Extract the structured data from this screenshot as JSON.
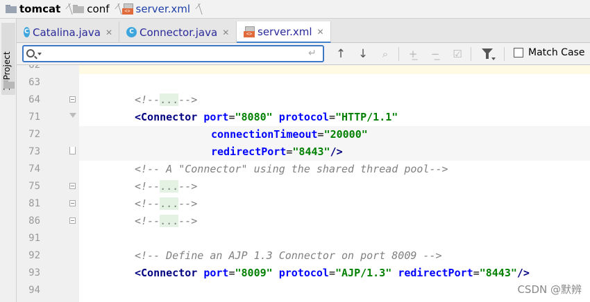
{
  "breadcrumb": {
    "project": "tomcat",
    "folder": "conf",
    "file": "server.xml"
  },
  "left_tool_window": {
    "label": "1: Project"
  },
  "tabs": [
    {
      "label": "Catalina.java",
      "icon": "class-icon",
      "icon_letter": "C",
      "active": false
    },
    {
      "label": "Connector.java",
      "icon": "class-icon",
      "icon_letter": "C",
      "active": false
    },
    {
      "label": "server.xml",
      "icon": "xml-icon",
      "active": true
    }
  ],
  "search": {
    "query": "",
    "match_case_label": "Match Case",
    "match_case_checked": false
  },
  "editor": {
    "lines": [
      {
        "num": "62",
        "text": ""
      },
      {
        "num": "63",
        "text": ""
      },
      {
        "num": "64",
        "text": "<!--...-->"
      },
      {
        "num": "71",
        "text": "<Connector port=\"8080\" protocol=\"HTTP/1.1\""
      },
      {
        "num": "72",
        "text": "connectionTimeout=\"20000\""
      },
      {
        "num": "73",
        "text": "redirectPort=\"8443\" />"
      },
      {
        "num": "74",
        "text": "<!-- A \"Connector\" using the shared thread pool-->"
      },
      {
        "num": "75",
        "text": "<!--...-->"
      },
      {
        "num": "81",
        "text": "<!--...-->"
      },
      {
        "num": "86",
        "text": "<!--...-->"
      },
      {
        "num": "91",
        "text": ""
      },
      {
        "num": "92",
        "text": "<!-- Define an AJP 1.3 Connector on port 8009 -->"
      },
      {
        "num": "93",
        "text": "<Connector port=\"8009\" protocol=\"AJP/1.3\" redirectPort=\"8443\" />"
      },
      {
        "num": "94",
        "text": ""
      }
    ],
    "tokens": {
      "fold_open": "<!--",
      "fold_dots": "...",
      "fold_close": "-->",
      "l74": "<!-- A \"Connector\" using the shared thread pool-->",
      "l92": "<!-- Define an AJP 1.3 Connector on port 8009 -->",
      "tag_open": "<Connector",
      "attr_port": "port",
      "val_8080": "\"8080\"",
      "attr_protocol": "protocol",
      "val_http": "\"HTTP/1.1\"",
      "attr_timeout": "connectionTimeout",
      "val_20000": "\"20000\"",
      "attr_redirect": "redirectPort",
      "val_8443": "\"8443\"",
      "tag_close": "/>",
      "val_8009": "\"8009\"",
      "val_ajp": "\"AJP/1.3\"",
      "eq": "="
    }
  },
  "watermark": "CSDN @默辨"
}
